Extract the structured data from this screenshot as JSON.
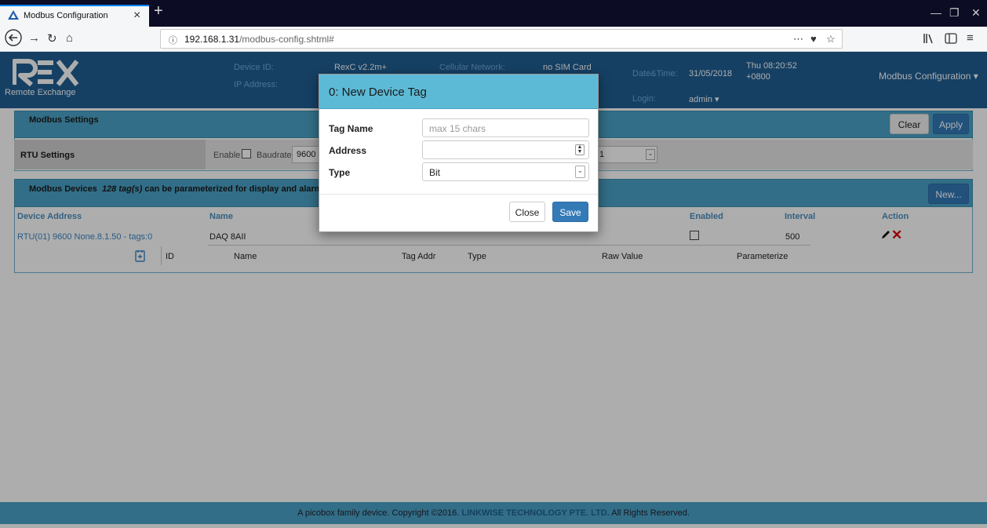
{
  "browser": {
    "tab_title": "Modbus Configuration",
    "url_host": "192.168.1.31",
    "url_path": "/modbus-config.shtml#",
    "menu_dots": "⋯"
  },
  "header": {
    "logo_text": "REX",
    "logo_subtitle": "Remote Exchange",
    "device_id_label": "Device ID:",
    "device_id_value": "RexC v2.2m+",
    "ip_label": "IP Address:",
    "cellular_label": "Cellular Network:",
    "cellular_value": "no SIM Card",
    "datetime_label": "Date&Time:",
    "date_value": "31/05/2018",
    "time_line1": "Thu 08:20:52",
    "time_line2": "+0800",
    "login_label": "Login:",
    "login_value": "admin ▾",
    "menu": "Modbus Configuration ▾"
  },
  "settings": {
    "title": "Modbus Settings",
    "clear_label": "Clear",
    "apply_label": "Apply",
    "rtu_title": "RTU Settings",
    "enable_label": "Enable",
    "baudrate_label": "Baudrate",
    "baudrate_value": "9600",
    "other_value": "1"
  },
  "devices": {
    "title": "Modbus Devices",
    "tag_count": "128 tag(s)",
    "tag_desc": "can be parameterized for display and alarm",
    "new_label": "New...",
    "columns": {
      "device_address": "Device Address",
      "name": "Name",
      "enabled": "Enabled",
      "interval": "Interval",
      "action": "Action"
    },
    "row": {
      "address": "RTU(01) 9600 None.8.1.50 - tags:0",
      "name": "DAQ 8AII",
      "interval": "500"
    },
    "tag_columns": {
      "id": "ID",
      "name": "Name",
      "tag_addr": "Tag Addr",
      "type": "Type",
      "raw_value": "Raw Value",
      "parameterize": "Parameterize"
    }
  },
  "modal": {
    "title": "0: New Device Tag",
    "tag_name_label": "Tag Name",
    "tag_name_placeholder": "max 15 chars",
    "address_label": "Address",
    "type_label": "Type",
    "type_value": "Bit",
    "close_label": "Close",
    "save_label": "Save"
  },
  "footer": {
    "prefix": "A picobox family device. Copyright ©2016.",
    "company": "LINKWISE TECHNOLOGY PTE. LTD.",
    "suffix": "All Rights Reserved."
  }
}
